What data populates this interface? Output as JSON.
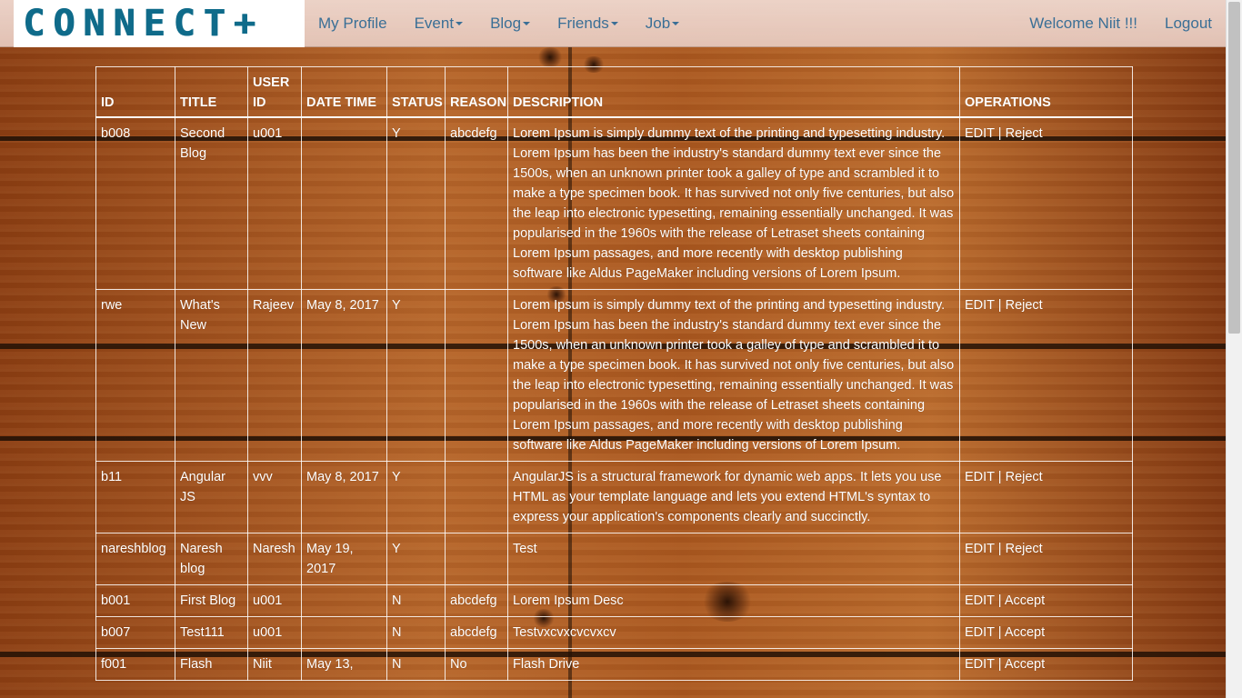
{
  "brand": {
    "logo_text": "CONNECT+"
  },
  "nav": {
    "left": [
      {
        "label": "My Profile",
        "dropdown": false
      },
      {
        "label": "Event",
        "dropdown": true
      },
      {
        "label": "Blog",
        "dropdown": true
      },
      {
        "label": "Friends",
        "dropdown": true
      },
      {
        "label": "Job",
        "dropdown": true
      }
    ],
    "welcome": "Welcome Niit !!!",
    "logout": "Logout"
  },
  "table": {
    "headers": [
      "ID",
      "TITLE",
      "USER ID",
      "DATE TIME",
      "STATUS",
      "REASON",
      "DESCRIPTION",
      "OPERATIONS"
    ],
    "separator": " | ",
    "rows": [
      {
        "id": "b008",
        "title": "Second Blog",
        "user_id": "u001",
        "date": "",
        "status": "Y",
        "reason": "abcdefg",
        "description": "Lorem Ipsum is simply dummy text of the printing and typesetting industry. Lorem Ipsum has been the industry's standard dummy text ever since the 1500s, when an unknown printer took a galley of type and scrambled it to make a type specimen book. It has survived not only five centuries, but also the leap into electronic typesetting, remaining essentially unchanged. It was popularised in the 1960s with the release of Letraset sheets containing Lorem Ipsum passages, and more recently with desktop publishing software like Aldus PageMaker including versions of Lorem Ipsum.",
        "op_edit": "EDIT",
        "op_action": "Reject"
      },
      {
        "id": "rwe",
        "title": "What's New",
        "user_id": "Rajeev",
        "date": "May 8, 2017",
        "status": "Y",
        "reason": "",
        "description": "Lorem Ipsum is simply dummy text of the printing and typesetting industry. Lorem Ipsum has been the industry's standard dummy text ever since the 1500s, when an unknown printer took a galley of type and scrambled it to make a type specimen book. It has survived not only five centuries, but also the leap into electronic typesetting, remaining essentially unchanged. It was popularised in the 1960s with the release of Letraset sheets containing Lorem Ipsum passages, and more recently with desktop publishing software like Aldus PageMaker including versions of Lorem Ipsum.",
        "op_edit": "EDIT",
        "op_action": "Reject"
      },
      {
        "id": "b11",
        "title": "Angular JS",
        "user_id": "vvv",
        "date": "May 8, 2017",
        "status": "Y",
        "reason": "",
        "description": "AngularJS is a structural framework for dynamic web apps. It lets you use HTML as your template language and lets you extend HTML's syntax to express your application's components clearly and succinctly.",
        "op_edit": "EDIT",
        "op_action": "Reject"
      },
      {
        "id": "nareshblog",
        "title": "Naresh blog",
        "user_id": "Naresh",
        "date": "May 19, 2017",
        "status": "Y",
        "reason": "",
        "description": "Test",
        "op_edit": "EDIT",
        "op_action": "Reject"
      },
      {
        "id": "b001",
        "title": "First Blog",
        "user_id": "u001",
        "date": "",
        "status": "N",
        "reason": "abcdefg",
        "description": "Lorem Ipsum Desc",
        "op_edit": "EDIT",
        "op_action": "Accept"
      },
      {
        "id": "b007",
        "title": "Test111",
        "user_id": "u001",
        "date": "",
        "status": "N",
        "reason": "abcdefg",
        "description": "Testvxcvxcvcvxcv",
        "op_edit": "EDIT",
        "op_action": "Accept"
      },
      {
        "id": "f001",
        "title": "Flash",
        "user_id": "Niit",
        "date": "May 13,",
        "status": "N",
        "reason": "No",
        "description": "Flash Drive",
        "op_edit": "EDIT",
        "op_action": "Accept"
      }
    ]
  }
}
